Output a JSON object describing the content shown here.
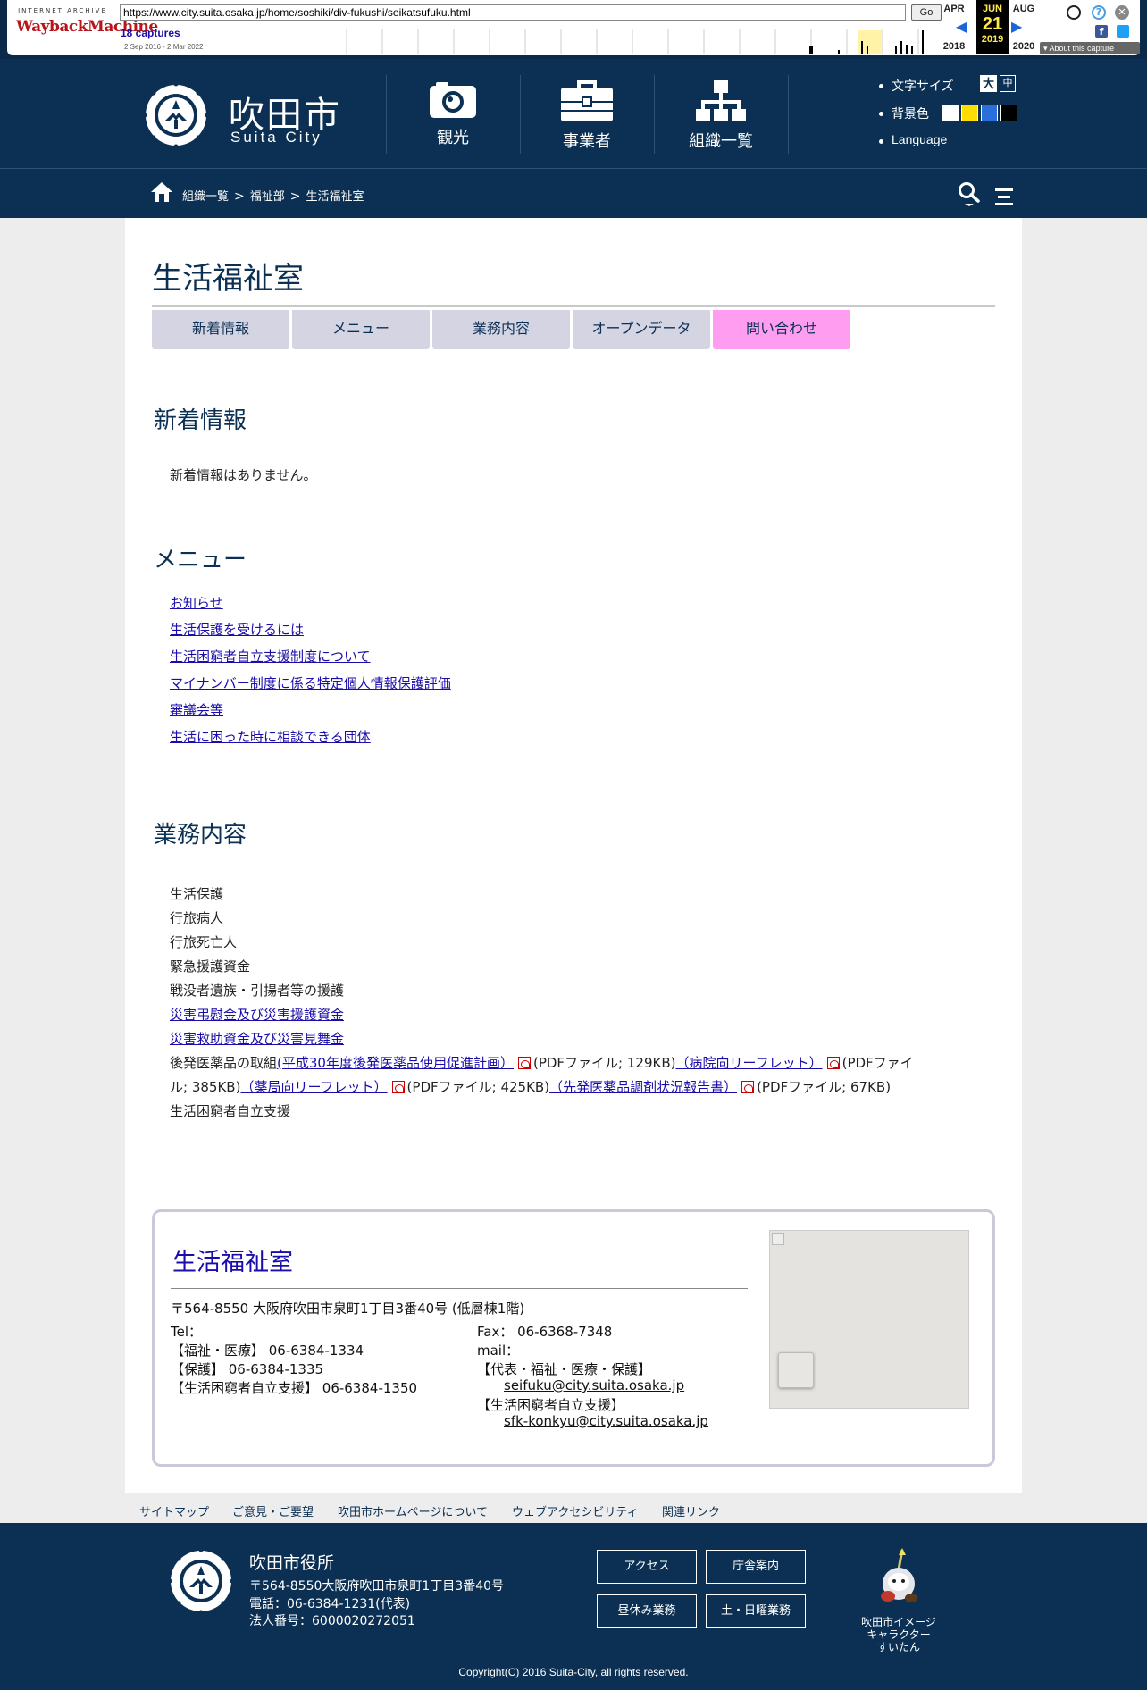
{
  "wayback": {
    "logo_top": "INTERNET ARCHIVE",
    "logo_bottom": "WaybackMachine",
    "url": "https://www.city.suita.osaka.jp/home/soshiki/div-fukushi/seikatsufuku.html",
    "go_label": "Go",
    "captures": "18 captures",
    "range": "2 Sep 2016 - 2 Mar 2022",
    "prev_month": "APR",
    "prev_year": "2018",
    "cur_month": "JUN",
    "cur_day": "21",
    "cur_year": "2019",
    "next_month": "AUG",
    "next_year": "2020",
    "about": "About this capture"
  },
  "header": {
    "site_title": "吹田市",
    "site_sub": "Suita City",
    "nav": [
      {
        "label": "観光",
        "icon": "camera-icon"
      },
      {
        "label": "事業者",
        "icon": "briefcase-icon"
      },
      {
        "label": "組織一覧",
        "icon": "org-chart-icon"
      }
    ],
    "util": {
      "font_size_label": "文字サイズ",
      "font_large": "大",
      "font_medium": "中",
      "bg_label": "背景色",
      "bg_colors": [
        "#ffffff",
        "#ffdd00",
        "#2a6fdb",
        "#000000"
      ],
      "language": "Language"
    }
  },
  "breadcrumb": [
    "組織一覧",
    "福祉部",
    "生活福祉室"
  ],
  "breadcrumb_sep": ">",
  "page": {
    "title": "生活福祉室",
    "tabs": [
      "新着情報",
      "メニュー",
      "業務内容",
      "オープンデータ",
      "問い合わせ"
    ],
    "news_heading": "新着情報",
    "news_empty": "新着情報はありません。",
    "menu_heading": "メニュー",
    "menu_links": [
      "お知らせ",
      "生活保護を受けるには",
      "生活困窮者自立支援制度について",
      "マイナンバー制度に係る特定個人情報保護評価",
      "審議会等",
      "生活に困った時に相談できる団体"
    ],
    "work_heading": "業務内容",
    "work_items": [
      "生活保護",
      "行旅病人",
      "行旅死亡人",
      "緊急援護資金",
      "戦没者遺族・引揚者等の援護"
    ],
    "work_links": [
      "災害弔慰金及び災害援護資金",
      "災害救助資金及び災害見舞金"
    ],
    "generic": {
      "prefix": "後発医薬品の取組",
      "link1": "(平成30年度後発医薬品使用促進計画）",
      "size1": "(PDFファイル; 129KB)",
      "link2": "（病院向リーフレット）",
      "size2a": "(PDFファイ",
      "size2b": "ル; 385KB)",
      "link3": "（薬局向リーフレット）",
      "size3": "(PDFファイル; 425KB)",
      "link4": "（先発医薬品調剤状況報告書）",
      "size4": "(PDFファイル; 67KB)"
    },
    "work_last": "生活困窮者自立支援"
  },
  "contact": {
    "title": "生活福祉室",
    "address": "〒564-8550  大阪府吹田市泉町1丁目3番40号   (低層棟1階)",
    "tel_label": "Tel：",
    "tel1": "【福祉・医療】 06-6384-1334",
    "tel2": "【保護】 06-6384-1335",
    "tel3": "【生活困窮者自立支援】 06-6384-1350",
    "fax": "Fax： 06-6368-7348",
    "mail_label": "mail：",
    "mail1_label": "【代表・福祉・医療・保護】",
    "mail1": "seifuku@city.suita.osaka.jp",
    "mail2_label": "【生活困窮者自立支援】",
    "mail2": "sfk-konkyu@city.suita.osaka.jp"
  },
  "footer_links": [
    "サイトマップ",
    "ご意見・ご要望",
    "吹田市ホームページについて",
    "ウェブアクセシビリティ",
    "関連リンク"
  ],
  "footer": {
    "name": "吹田市役所",
    "address": "〒564-8550大阪府吹田市泉町1丁目3番40号",
    "phone": "電話：06-6384-1231(代表)",
    "corp": "法人番号：6000020272051",
    "buttons": [
      "アクセス",
      "庁舎案内",
      "昼休み業務",
      "土・日曜業務"
    ],
    "mascot_caption": [
      "吹田市イメージ",
      "キャラクター",
      "すいたん"
    ],
    "copyright": "Copyright(C) 2016 Suita-City, all rights reserved."
  }
}
